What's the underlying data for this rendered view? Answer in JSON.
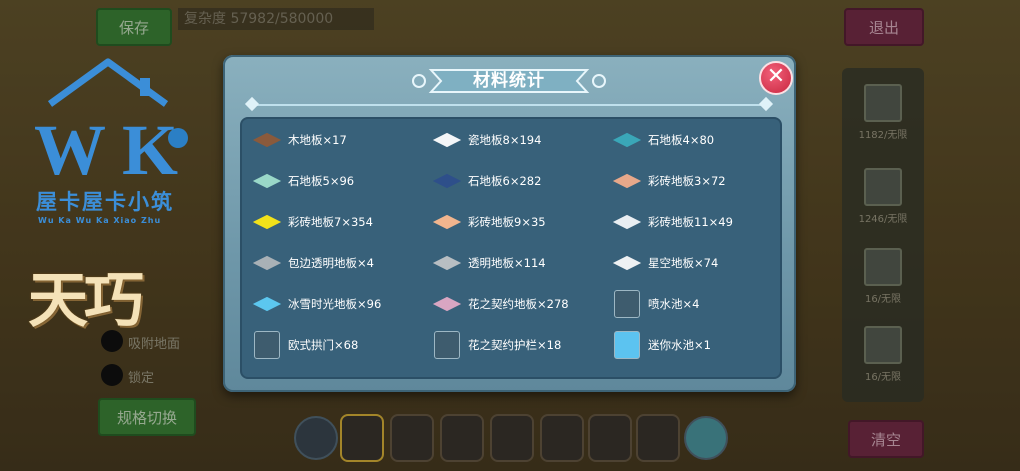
{
  "background": {
    "save_label": "保存",
    "capacity_text": "复杂度 57982/580000",
    "exit_label": "退出",
    "clear_label": "清空",
    "switch_label": "规格切换",
    "radio_1_label": "吸附地面",
    "radio_2_label": "锁定",
    "right_panel_items": [
      "1182/无限",
      "1246/无限",
      "16/无限",
      "16/无限"
    ]
  },
  "logo": {
    "house_text": "屋卡屋卡小筑",
    "pinyin": "Wu  Ka  Wu  Ka  Xiao  Zhu",
    "brand_text": "天巧"
  },
  "dialog": {
    "title": "材料统计",
    "close_symbol": "✕",
    "materials": [
      {
        "label": "木地板×17",
        "icon": "wood-floor-icon",
        "color": "#8a5a3c"
      },
      {
        "label": "瓷地板8×194",
        "icon": "tile-floor-icon",
        "color": "#f4f6f8"
      },
      {
        "label": "石地板4×80",
        "icon": "stone-floor-icon",
        "color": "#3aa7b8"
      },
      {
        "label": "石地板5×96",
        "icon": "stone-floor-icon",
        "color": "#9ad8c8"
      },
      {
        "label": "石地板6×282",
        "icon": "stone-floor-icon",
        "color": "#2e4f8a"
      },
      {
        "label": "彩砖地板3×72",
        "icon": "color-brick-floor-icon",
        "color": "#e7a88a"
      },
      {
        "label": "彩砖地板7×354",
        "icon": "color-brick-floor-icon",
        "color": "#f2e21a"
      },
      {
        "label": "彩砖地板9×35",
        "icon": "color-brick-floor-icon",
        "color": "#f1b58e"
      },
      {
        "label": "彩砖地板11×49",
        "icon": "color-brick-floor-icon",
        "color": "#e9eef2"
      },
      {
        "label": "包边透明地板×4",
        "icon": "glass-floor-icon",
        "color": "#a9b1b6"
      },
      {
        "label": "透明地板×114",
        "icon": "glass-floor-icon",
        "color": "#b8bec2"
      },
      {
        "label": "星空地板×74",
        "icon": "star-floor-icon",
        "color": "#eef1f3"
      },
      {
        "label": "冰雪时光地板×96",
        "icon": "ice-floor-icon",
        "color": "#5cc7ef"
      },
      {
        "label": "花之契约地板×278",
        "icon": "flower-floor-icon",
        "color": "#d9a6c2"
      },
      {
        "label": "喷水池×4",
        "icon": "fountain-icon",
        "color": "#d8e6f0"
      },
      {
        "label": "欧式拱门×68",
        "icon": "arch-door-icon",
        "color": "#cfd6db"
      },
      {
        "label": "花之契约护栏×18",
        "icon": "flower-fence-icon",
        "color": "#e9eef2"
      },
      {
        "label": "迷你水池×1",
        "icon": "mini-pool-icon",
        "color": "#5cc3f0"
      }
    ]
  }
}
